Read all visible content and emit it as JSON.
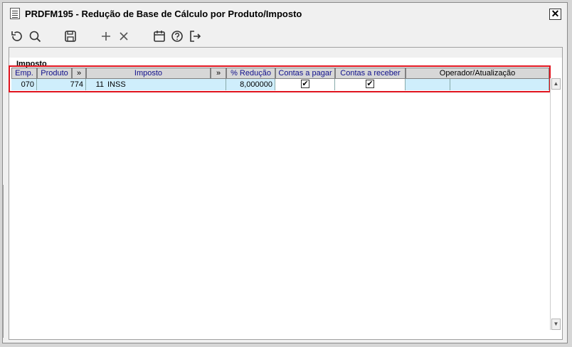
{
  "window": {
    "title": "PRDFM195 - Redução de Base de Cálculo por Produto/Imposto",
    "close_label": "✕"
  },
  "toolbar": {
    "icons": [
      "refresh-icon",
      "search-icon",
      "save-icon",
      "add-icon",
      "delete-icon",
      "calendar-icon",
      "help-icon",
      "exit-icon"
    ]
  },
  "section": {
    "title": "Imposto"
  },
  "table": {
    "headers": {
      "emp": "Emp.",
      "produto": "Produto",
      "expand1": "»",
      "imposto": "Imposto",
      "expand2": "»",
      "reducao": "% Redução",
      "contas_pagar": "Contas a pagar",
      "contas_receber": "Contas a receber",
      "operador": "Operador/Atualização"
    },
    "rows": [
      {
        "emp": "070",
        "produto": "774",
        "imposto_codigo": "11",
        "imposto_nome": "INSS",
        "reducao": "8,000000",
        "contas_pagar": true,
        "contas_receber": true,
        "operador": "",
        "atualizacao": ""
      }
    ]
  },
  "colors": {
    "header_text": "#10108c",
    "row_bg": "#cfeefc",
    "highlight_border": "#e0141e"
  }
}
